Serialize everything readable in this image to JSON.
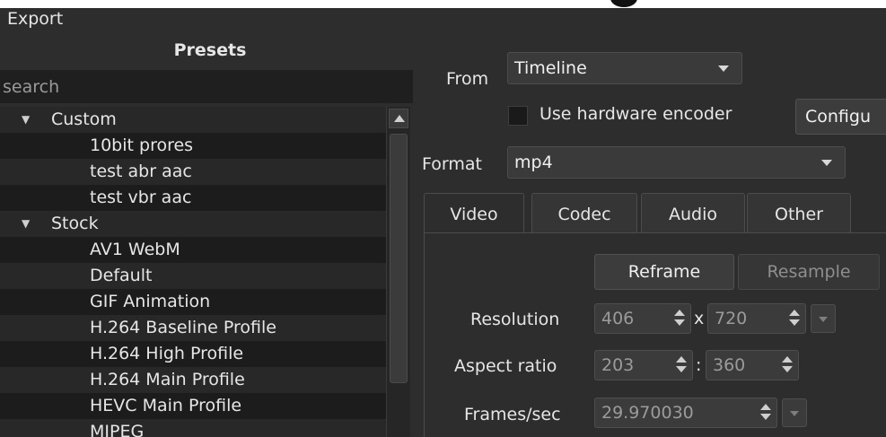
{
  "dock": {
    "title": "Export"
  },
  "presets": {
    "header": "Presets",
    "search_placeholder": "search",
    "tree": [
      {
        "type": "group",
        "label": "Custom",
        "expanded": true
      },
      {
        "type": "leaf",
        "label": "10bit prores"
      },
      {
        "type": "leaf",
        "label": "test abr aac"
      },
      {
        "type": "leaf",
        "label": "test vbr aac"
      },
      {
        "type": "group",
        "label": "Stock",
        "expanded": true
      },
      {
        "type": "leaf",
        "label": "AV1 WebM"
      },
      {
        "type": "leaf",
        "label": "Default"
      },
      {
        "type": "leaf",
        "label": "GIF Animation"
      },
      {
        "type": "leaf",
        "label": "H.264 Baseline Profile"
      },
      {
        "type": "leaf",
        "label": "H.264 High Profile"
      },
      {
        "type": "leaf",
        "label": "H.264 Main Profile"
      },
      {
        "type": "leaf",
        "label": "HEVC Main Profile"
      },
      {
        "type": "leaf",
        "label": "MJPEG"
      }
    ]
  },
  "export_form": {
    "from_label": "From",
    "from_value": "Timeline",
    "hw_encoder_label": "Use hardware encoder",
    "hw_encoder_checked": false,
    "configure_label": "Configu",
    "format_label": "Format",
    "format_value": "mp4",
    "tabs": [
      {
        "label": "Video",
        "active": true
      },
      {
        "label": "Codec",
        "active": false
      },
      {
        "label": "Audio",
        "active": false
      },
      {
        "label": "Other",
        "active": false
      }
    ],
    "reframe_label": "Reframe",
    "resample_label": "Resample",
    "resolution_label": "Resolution",
    "resolution_width": "406",
    "resolution_sep": "x",
    "resolution_height": "720",
    "aspect_label": "Aspect ratio",
    "aspect_num": "203",
    "aspect_sep": ":",
    "aspect_den": "360",
    "fps_label": "Frames/sec",
    "fps_value": "29.970030"
  },
  "colors": {
    "panel_bg": "#2d2d2d",
    "list_bg": "#232323",
    "row_alt": "#1c1c1c",
    "text": "#e6e6e6",
    "disabled_text": "#9b9b9b"
  }
}
